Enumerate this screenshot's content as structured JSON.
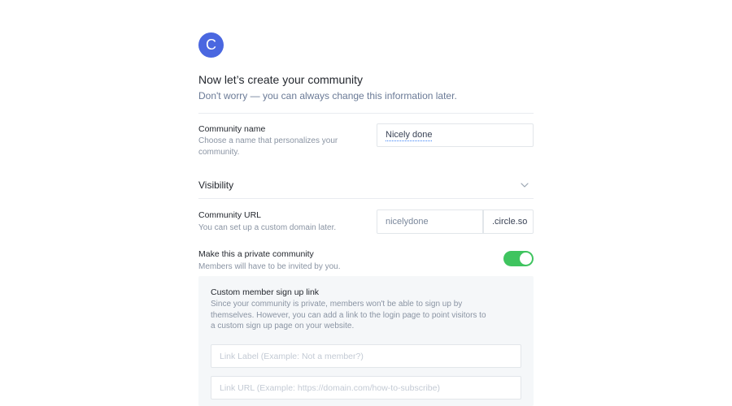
{
  "header": {
    "avatar_letter": "C",
    "title": "Now let’s create your community",
    "subtitle": "Don't worry — you can always change this information later."
  },
  "community_name": {
    "label": "Community name",
    "help": "Choose a name that personalizes your community.",
    "value": "Nicely done"
  },
  "visibility": {
    "title": "Visibility",
    "icon": "chevron-down-icon"
  },
  "community_url": {
    "label": "Community URL",
    "help": "You can set up a custom domain later.",
    "value": "nicelydone",
    "suffix": ".circle.so"
  },
  "private_community": {
    "label": "Make this a private community",
    "help": "Members will have to be invited by you.",
    "enabled": true
  },
  "custom_signup": {
    "title": "Custom member sign up link",
    "description": "Since your community is private, members won't be able to sign up by themselves. However, you can add a link to the login page to point visitors to a custom sign up page on your website.",
    "link_label_placeholder": "Link Label (Example: Not a member?)",
    "link_url_placeholder": "Link URL (Example: https://domain.com/how-to-subscribe)"
  },
  "colors": {
    "accent": "#4a67e0",
    "toggle_on": "#3fc45f",
    "panel_bg": "#f5f7f9"
  }
}
